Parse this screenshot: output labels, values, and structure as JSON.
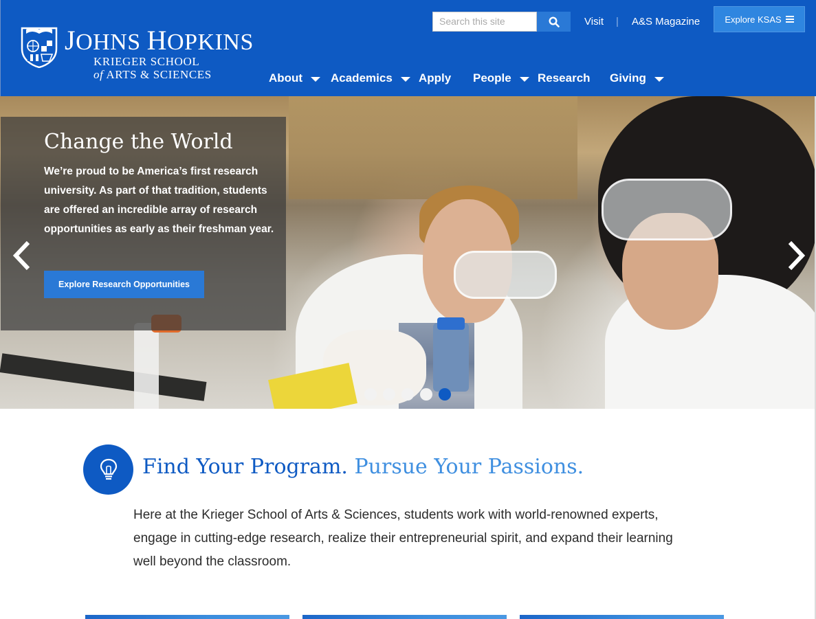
{
  "header": {
    "logo": {
      "name_first": "J",
      "name_rest": "OHNS",
      "name_second_first": "H",
      "name_second_rest": "OPKINS",
      "school_line1": "KRIEGER SCHOOL",
      "school_line2_prefix": "of",
      "school_line2": "ARTS & SCIENCES"
    },
    "search": {
      "placeholder": "Search this site",
      "icon": "search-icon"
    },
    "top_links": [
      "Visit",
      "A&S Magazine"
    ],
    "separator": "|",
    "explore_label": "Explore KSAS",
    "nav": [
      {
        "label": "About",
        "dropdown": true
      },
      {
        "label": "Academics",
        "dropdown": true
      },
      {
        "label": "Apply",
        "dropdown": false
      },
      {
        "label": "People",
        "dropdown": true
      },
      {
        "label": "Research",
        "dropdown": false
      },
      {
        "label": "Giving",
        "dropdown": true
      }
    ],
    "colors": {
      "brand": "#0e5ac3",
      "accent": "#2a79d6"
    }
  },
  "hero": {
    "title": "Change the World",
    "text": "We’re proud to be America’s first research university. As part of that tradition, students are offered an incredible array of research opportunities as early as their freshman year.",
    "button_label": "Explore Research Opportunities",
    "slide_count": 5,
    "active_slide": 5
  },
  "program": {
    "icon": "lightbulb-icon",
    "headline_part1": "Find Your Program.",
    "headline_part2": "Pursue Your Passions.",
    "body": "Here at the Krieger School of Arts & Sciences, students work with world-renowned experts, engage in cutting-edge research, realize their entrepreneurial spirit, and expand their learning well beyond the classroom."
  }
}
